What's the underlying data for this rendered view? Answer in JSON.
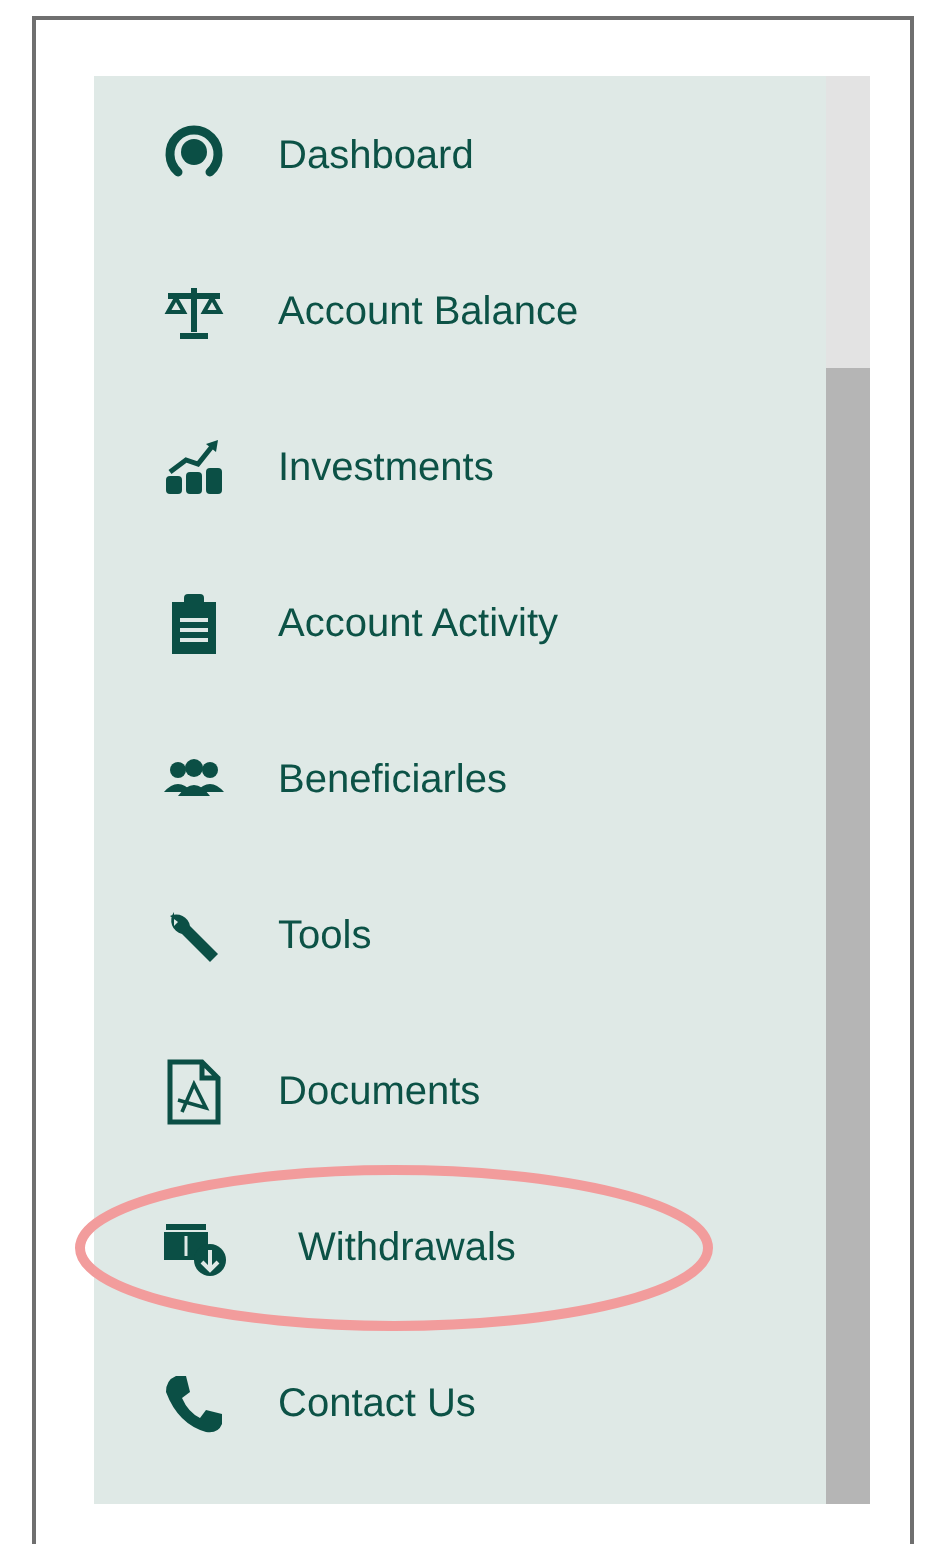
{
  "sidebar": {
    "items": [
      {
        "label": "Dashboard",
        "highlighted": false
      },
      {
        "label": "Account Balance",
        "highlighted": false
      },
      {
        "label": "Investments",
        "highlighted": false
      },
      {
        "label": "Account Activity",
        "highlighted": false
      },
      {
        "label": "Beneficiarles",
        "highlighted": false
      },
      {
        "label": "Tools",
        "highlighted": false
      },
      {
        "label": "Documents",
        "highlighted": false
      },
      {
        "label": "Withdrawals",
        "highlighted": true
      },
      {
        "label": "Contact Us",
        "highlighted": false
      }
    ]
  }
}
